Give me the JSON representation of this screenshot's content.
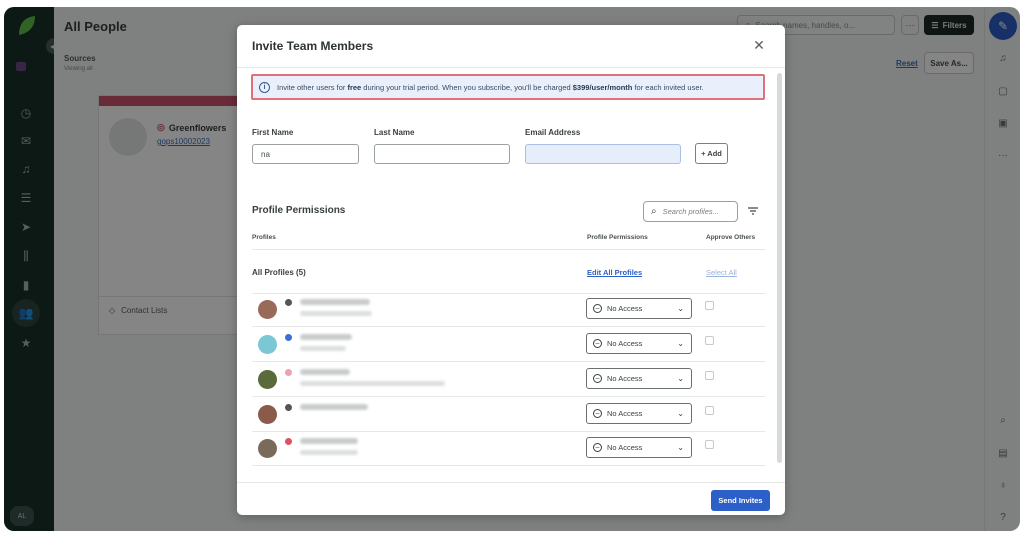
{
  "background": {
    "title": "All People",
    "sources_label": "Sources",
    "sources_sub": "Viewing all",
    "search_placeholder": "Search names, handles, o...",
    "more_label": "···",
    "filters_label": "Filters",
    "reset_label": "Reset",
    "save_as_label": "Save As...",
    "card": {
      "name": "Greenflowers",
      "handle": "gops10002023",
      "contact_lists": "Contact Lists"
    },
    "user_initials": "AL"
  },
  "modal": {
    "title": "Invite Team Members",
    "notice": {
      "prefix": "Invite other users for ",
      "free": "free",
      "middle": " during your trial period. When you subscribe, you'll be charged ",
      "price": "$399/user/month",
      "suffix": " for each invited user."
    },
    "form": {
      "first_name_label": "First Name",
      "first_name_value": "na",
      "last_name_label": "Last Name",
      "last_name_value": "",
      "email_label": "Email Address",
      "email_value": "",
      "add_label": "+ Add"
    },
    "permissions": {
      "title": "Profile Permissions",
      "search_placeholder": "Search profiles...",
      "col_profiles": "Profiles",
      "col_permissions": "Profile Permissions",
      "col_approve": "Approve Others",
      "all_profiles": "All Profiles (5)",
      "edit_all": "Edit All Profiles",
      "select_all": "Select All",
      "rows": [
        {
          "permission": "No Access",
          "avatar_color": "#9a6a58",
          "network_color": "#555555"
        },
        {
          "permission": "No Access",
          "avatar_color": "#7cc7d6",
          "network_color": "#3b6fd8"
        },
        {
          "permission": "No Access",
          "avatar_color": "#5a6a3a",
          "network_color": "#f0a0b0"
        },
        {
          "permission": "No Access",
          "avatar_color": "#8a5a4a",
          "network_color": "#555555"
        },
        {
          "permission": "No Access",
          "avatar_color": "#7a6a5a",
          "network_color": "#e05060"
        }
      ]
    },
    "send_label": "Send Invites"
  }
}
